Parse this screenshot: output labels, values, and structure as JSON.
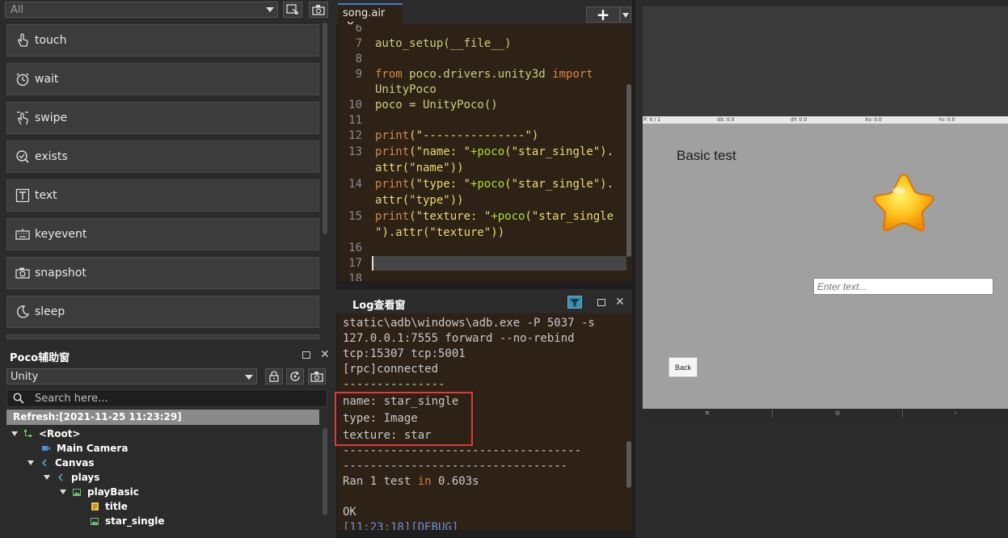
{
  "left_panel": {
    "filter_value": "All",
    "commands": [
      {
        "label": "touch",
        "icon": "touch-icon"
      },
      {
        "label": "wait",
        "icon": "clock-icon"
      },
      {
        "label": "swipe",
        "icon": "swipe-icon"
      },
      {
        "label": "exists",
        "icon": "check-circle-icon"
      },
      {
        "label": "text",
        "icon": "text-icon"
      },
      {
        "label": "keyevent",
        "icon": "keyboard-icon"
      },
      {
        "label": "snapshot",
        "icon": "camera-icon"
      },
      {
        "label": "sleep",
        "icon": "moon-icon"
      }
    ]
  },
  "poco": {
    "title": "Poco辅助窗",
    "mode": "Unity",
    "search_placeholder": "Search here...",
    "refresh": "Refresh:[2021-11-25 11:23:29]",
    "tree": [
      {
        "label": "<Root>",
        "level": 0,
        "expanded": true
      },
      {
        "label": "Main Camera",
        "level": 1,
        "expanded": false
      },
      {
        "label": "Canvas",
        "level": 1,
        "expanded": true
      },
      {
        "label": "plays",
        "level": 2,
        "expanded": true
      },
      {
        "label": "playBasic",
        "level": 3,
        "expanded": true
      },
      {
        "label": "title",
        "level": 4,
        "expanded": false
      },
      {
        "label": "star_single",
        "level": 4,
        "expanded": false
      }
    ]
  },
  "editor": {
    "tab": "song.air",
    "add_label": "+",
    "line_numbers": [
      "6",
      "7",
      "8",
      "9",
      "10",
      "11",
      "12",
      "13",
      "14",
      "15",
      "16",
      "17",
      "18"
    ],
    "code": {
      "l7": "auto_setup(__file__)",
      "l9_kw_from": "from",
      "l9_mod": " poco.drivers.unity3d ",
      "l9_kw_import": "import",
      "l9b": "UnityPoco",
      "l10": "poco = UnityPoco()",
      "l12_fn": "print",
      "l12_str": "(\"---------------\")",
      "l13a_fn": "print",
      "l13a_str": "(\"name: \"",
      "l13a_op": "+poco",
      "l13a_rest": "(\"star_single\").",
      "l13b": "attr(\"name\"))",
      "l14a_fn": "print",
      "l14a_str": "(\"type: \"",
      "l14a_op": "+poco",
      "l14a_rest": "(\"star_single\").",
      "l14b": "attr(\"type\"))",
      "l15a_fn": "print",
      "l15a_str": "(\"texture: \"",
      "l15a_op": "+poco",
      "l15a_rest": "(\"star_single",
      "l15b": "\").attr(\"texture\"))"
    }
  },
  "log": {
    "title": "Log查看窗",
    "lines": [
      "static\\adb\\windows\\adb.exe -P 5037 -s",
      "127.0.0.1:7555 forward --no-rebind",
      "tcp:15307 tcp:5001",
      "[rpc]connected",
      "---------------",
      "name: star_single",
      "type: Image",
      "texture: star",
      "-----------------------------------",
      "---------------------------------",
      "Ran 1 test in 0.603s",
      "",
      "OK",
      "[11:23:18][DEBUG]"
    ]
  },
  "device": {
    "status": {
      "p": "P: 0 / 1",
      "dx": "dX: 0.0",
      "dy": "dY: 0.0",
      "xv": "Xv: 0.0",
      "yv": "Yv: 0.0"
    },
    "title": "Basic test",
    "input_placeholder": "Enter text...",
    "back_label": "Back",
    "nav": {
      "menu": "≡",
      "home": "◎",
      "back": "‹"
    }
  },
  "colors": {
    "highlight_box": "#e03a3a",
    "tab_accent": "#3c7fd6",
    "code_bg": "#2e2217"
  }
}
